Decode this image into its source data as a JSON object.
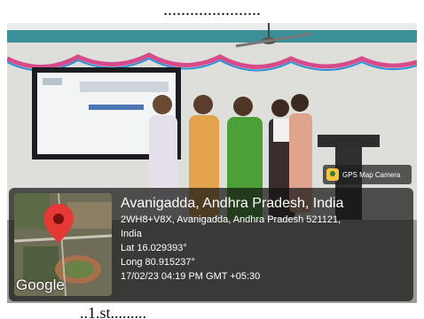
{
  "captions": {
    "top": "......................",
    "bottom": "..1.st........."
  },
  "gps": {
    "badge_label": "GPS Map Camera",
    "title": "Avanigadda, Andhra Pradesh, India",
    "address_line1": "2WH8+V8X, Avanigadda, Andhra Pradesh 521121,",
    "address_line2": "India",
    "lat": "Lat 16.029393°",
    "long": "Long 80.915237°",
    "datetime": "17/02/23 04:19 PM GMT +05:30",
    "map_brand": "Google",
    "pin_color": "#e53935"
  }
}
